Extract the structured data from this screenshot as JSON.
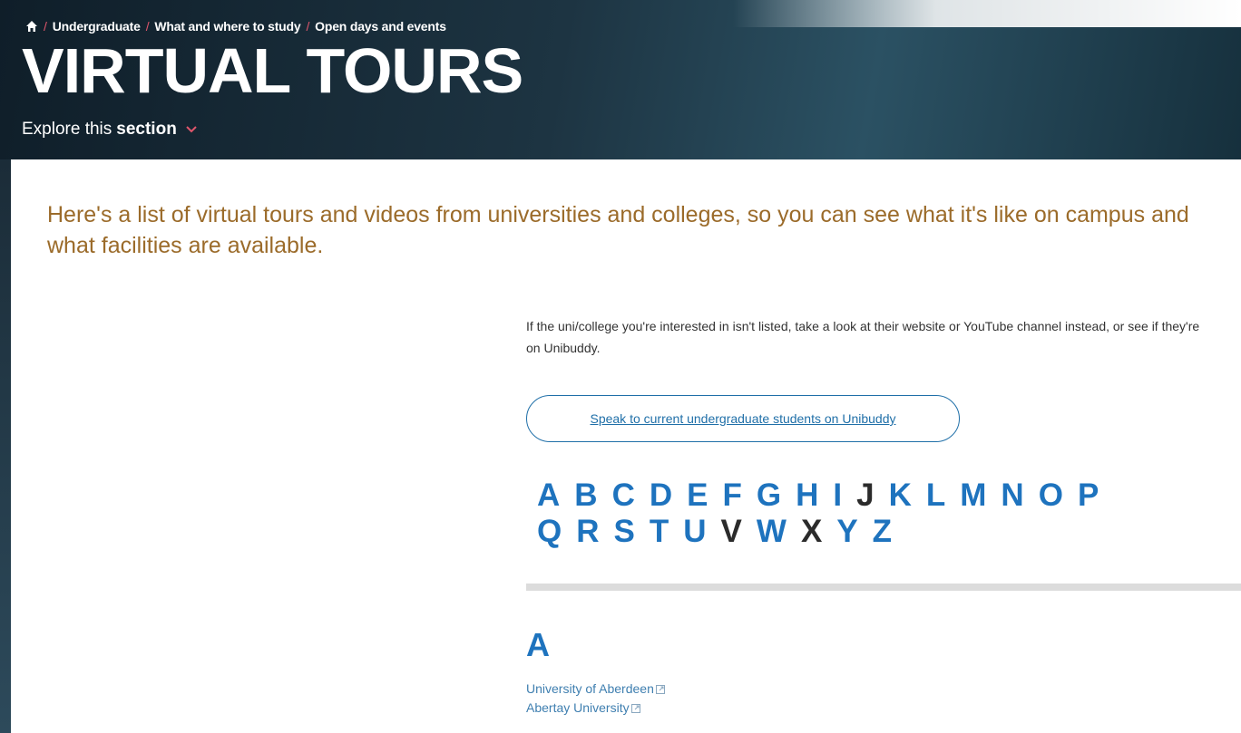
{
  "breadcrumb": {
    "items": [
      {
        "label": "Undergraduate"
      },
      {
        "label": "What and where to study"
      },
      {
        "label": "Open days and events"
      }
    ],
    "separator": "/"
  },
  "page": {
    "title": "VIRTUAL TOURS",
    "explore_prefix": "Explore this",
    "explore_bold": "section"
  },
  "content": {
    "intro": "Here's a list of virtual tours and videos from universities and colleges, so you can see what it's like on campus and what facilities are available.",
    "body": "If the uni/college you're interested in isn't listed, take a look at their website or YouTube channel instead, or see if they're on Unibuddy.",
    "cta_label": "Speak to current undergraduate students on Unibuddy"
  },
  "alphabet": {
    "row1": [
      {
        "letter": "A",
        "active": true
      },
      {
        "letter": "B",
        "active": true
      },
      {
        "letter": "C",
        "active": true
      },
      {
        "letter": "D",
        "active": true
      },
      {
        "letter": "E",
        "active": true
      },
      {
        "letter": "F",
        "active": true
      },
      {
        "letter": "G",
        "active": true
      },
      {
        "letter": "H",
        "active": true
      },
      {
        "letter": "I",
        "active": true
      },
      {
        "letter": "J",
        "active": false
      },
      {
        "letter": "K",
        "active": true
      },
      {
        "letter": "L",
        "active": true
      },
      {
        "letter": "M",
        "active": true
      },
      {
        "letter": "N",
        "active": true
      },
      {
        "letter": "O",
        "active": true
      },
      {
        "letter": "P",
        "active": true
      }
    ],
    "row2": [
      {
        "letter": "Q",
        "active": true
      },
      {
        "letter": "R",
        "active": true
      },
      {
        "letter": "S",
        "active": true
      },
      {
        "letter": "T",
        "active": true
      },
      {
        "letter": "U",
        "active": true
      },
      {
        "letter": "V",
        "active": false
      },
      {
        "letter": "W",
        "active": true
      },
      {
        "letter": "X",
        "active": false
      },
      {
        "letter": "Y",
        "active": true
      },
      {
        "letter": "Z",
        "active": true
      }
    ]
  },
  "section_a": {
    "heading": "A",
    "universities": [
      {
        "name": "University of Aberdeen",
        "icon": "external-link-icon"
      },
      {
        "name": "Abertay University",
        "icon": "external-link-icon"
      }
    ]
  },
  "colors": {
    "accent": "#1e73be",
    "intro": "#9b6b2a",
    "breadcrumb_separator": "#e0566c"
  }
}
